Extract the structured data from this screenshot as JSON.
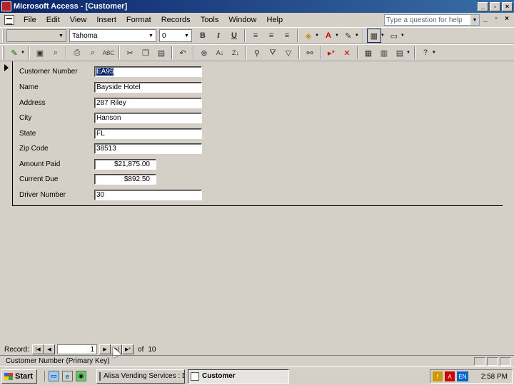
{
  "window": {
    "title": "Microsoft Access - [Customer]",
    "min": "_",
    "max": "▫",
    "close": "×"
  },
  "menu": {
    "items": [
      "File",
      "Edit",
      "View",
      "Insert",
      "Format",
      "Records",
      "Tools",
      "Window",
      "Help"
    ],
    "help_placeholder": "Type a question for help",
    "doc_controls": [
      "_",
      "▫",
      "×"
    ]
  },
  "format_toolbar": {
    "object_combo": "",
    "font_name": "Tahoma",
    "font_size": "0"
  },
  "form": {
    "fields": [
      {
        "label": "Customer Number",
        "value": "EA95",
        "selected": true
      },
      {
        "label": "Name",
        "value": "Bayside Hotel"
      },
      {
        "label": "Address",
        "value": "287 Riley"
      },
      {
        "label": "City",
        "value": "Hanson"
      },
      {
        "label": "State",
        "value": "FL"
      },
      {
        "label": "Zip Code",
        "value": "38513"
      },
      {
        "label": "Amount Paid",
        "value": "$21,875.00"
      },
      {
        "label": "Current Due",
        "value": "$892.50"
      },
      {
        "label": "Driver Number",
        "value": "30"
      }
    ]
  },
  "record_nav": {
    "label": "Record:",
    "current": "1",
    "of_label": "of",
    "total": "10"
  },
  "status": {
    "text": "Customer Number (Primary Key)"
  },
  "taskbar": {
    "start": "Start",
    "tasks": [
      "Alisa Vending Services : D...",
      "Customer"
    ],
    "clock": "2:58 PM",
    "tray_lang": "EN"
  }
}
